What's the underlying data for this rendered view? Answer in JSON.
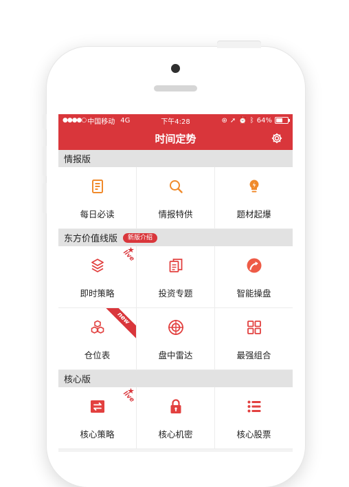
{
  "status": {
    "carrier": "中国移动",
    "network": "4G",
    "time": "下午4:28",
    "battery": "64%",
    "battery_level": 0.64
  },
  "nav": {
    "title": "时间定势",
    "settings_icon": "gear-icon"
  },
  "sections": [
    {
      "title": "情报版",
      "items": [
        {
          "label": "每日必读",
          "icon": "document-icon"
        },
        {
          "label": "情报特供",
          "icon": "magnifier-icon"
        },
        {
          "label": "题材起爆",
          "icon": "bulb-icon"
        }
      ]
    },
    {
      "title": "东方价值线版",
      "badge": "新版介绍",
      "rows": [
        [
          {
            "label": "即时策略",
            "icon": "layers-icon",
            "ribbon": "live"
          },
          {
            "label": "投资专题",
            "icon": "files-icon"
          },
          {
            "label": "智能操盘",
            "icon": "trend-arrow-icon"
          }
        ],
        [
          {
            "label": "仓位表",
            "icon": "boxes-icon",
            "ribbon": "new"
          },
          {
            "label": "盘中雷达",
            "icon": "radar-icon"
          },
          {
            "label": "最强组合",
            "icon": "grid-icon"
          }
        ]
      ]
    },
    {
      "title": "核心版",
      "items": [
        {
          "label": "核心策略",
          "icon": "exchange-icon",
          "ribbon": "live"
        },
        {
          "label": "核心机密",
          "icon": "lock-icon"
        },
        {
          "label": "核心股票",
          "icon": "list-icon"
        }
      ]
    }
  ],
  "ribbons": {
    "live": "live",
    "new": "new"
  },
  "colors": {
    "brand_red": "#d9363b",
    "orange": "#f08a2b",
    "section_bg": "#e2e2e2"
  }
}
